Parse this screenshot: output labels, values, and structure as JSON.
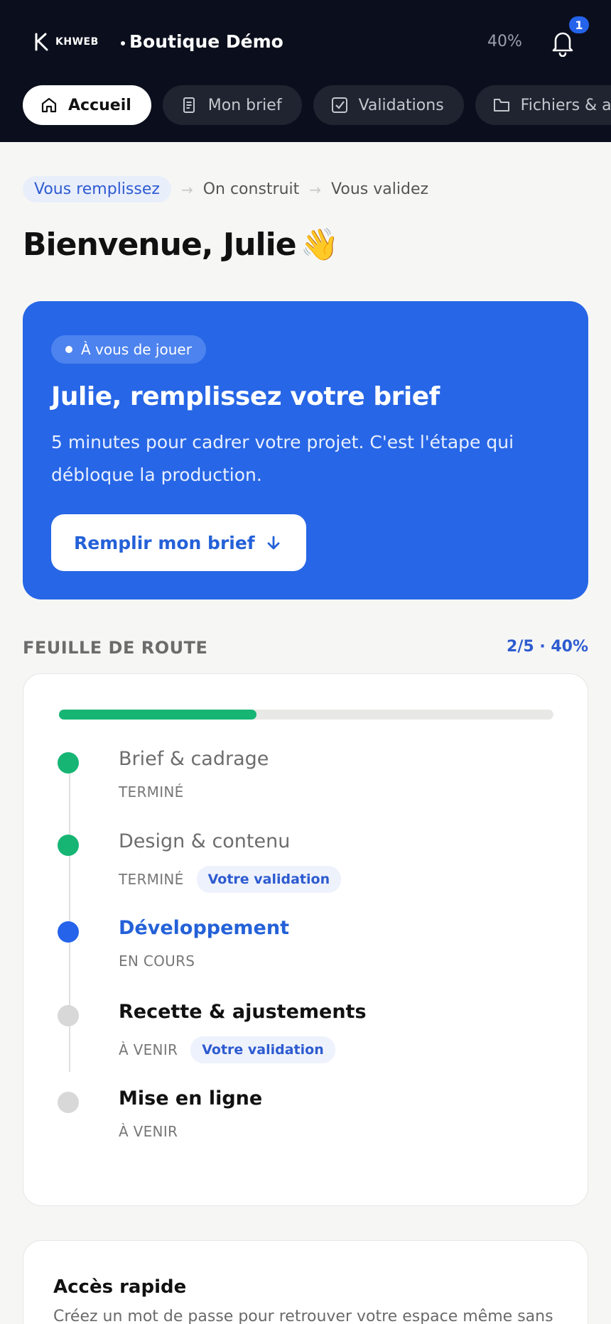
{
  "header": {
    "logo_text": "KHWEB",
    "project_title": "Boutique Démo",
    "progress": "40%",
    "notification_count": "1"
  },
  "tabs": [
    {
      "label": "Accueil",
      "icon": "home-icon",
      "active": true
    },
    {
      "label": "Mon brief",
      "icon": "document-icon",
      "active": false
    },
    {
      "label": "Validations",
      "icon": "checkbox-icon",
      "active": false
    },
    {
      "label": "Fichiers & a",
      "icon": "folder-icon",
      "active": false
    }
  ],
  "steps": [
    "Vous remplissez",
    "On construit",
    "Vous validez"
  ],
  "welcome": {
    "text": "Bienvenue, Julie",
    "emoji": "👋"
  },
  "hero": {
    "pill": "À vous de jouer",
    "title": "Julie, remplissez votre brief",
    "description": "5 minutes pour cadrer votre projet. C'est l'étape qui débloque la production.",
    "button": "Remplir mon brief",
    "color": "#2766e6"
  },
  "roadmap": {
    "title": "FEUILLE DE ROUTE",
    "summary": "2/5 · 40%",
    "progress_fraction": 0.4,
    "milestones": [
      {
        "name": "Brief & cadrage",
        "status": "TERMINÉ",
        "badge": ""
      },
      {
        "name": "Design & contenu",
        "status": "TERMINÉ",
        "badge": "Votre validation"
      },
      {
        "name": "Développement",
        "status": "EN COURS",
        "badge": ""
      },
      {
        "name": "Recette & ajustements",
        "status": "À VENIR",
        "badge": "Votre validation"
      },
      {
        "name": "Mise en ligne",
        "status": "À VENIR",
        "badge": ""
      }
    ]
  },
  "quick_access": {
    "title": "Accès rapide",
    "description": "Créez un mot de passe pour retrouver votre espace même sans"
  },
  "colors": {
    "done": "#16b574",
    "current": "#2563eb",
    "upcoming": "#d8d8d8",
    "header_bg": "#0b0f1d"
  }
}
